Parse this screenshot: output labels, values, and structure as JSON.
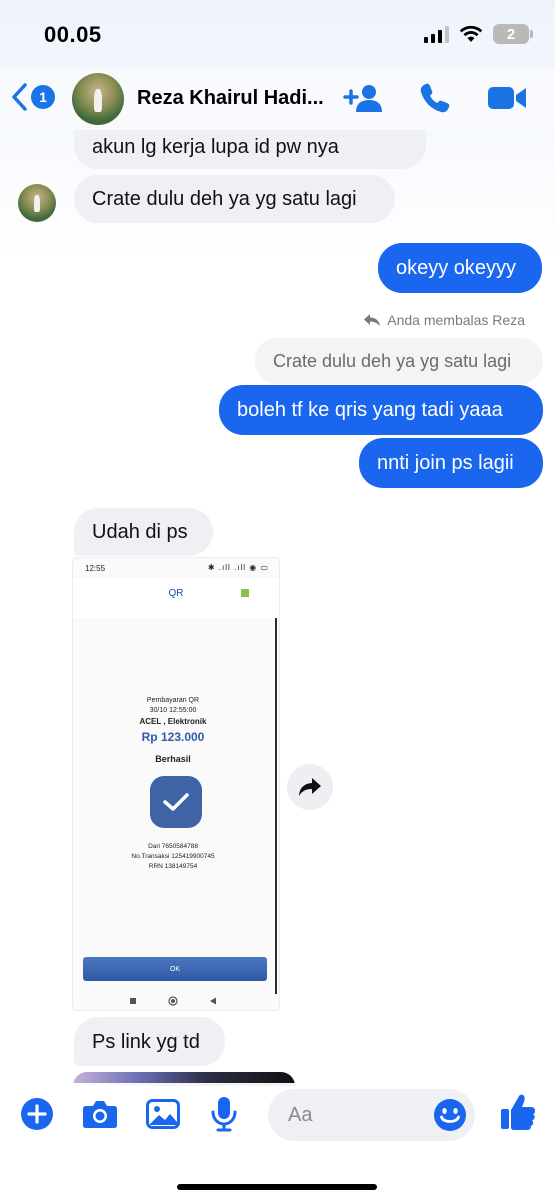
{
  "status_bar": {
    "time": "00.05",
    "battery": "2"
  },
  "header": {
    "back_badge": "1",
    "contact_name": "Reza Khairul Hadi..."
  },
  "messages": [
    {
      "type": "in",
      "text": "akun lg kerja lupa id pw nya"
    },
    {
      "type": "in",
      "text": "Crate dulu deh ya yg satu lagi"
    },
    {
      "type": "out",
      "text": "okeyy okeyyy"
    },
    {
      "type": "reply_note",
      "text": "Anda membalas Reza"
    },
    {
      "type": "quote",
      "text": "Crate dulu deh ya yg satu lagi"
    },
    {
      "type": "out",
      "text": "boleh tf ke qris yang tadi yaaa"
    },
    {
      "type": "out",
      "text": "nnti join ps lagii"
    },
    {
      "type": "in",
      "text": "Udah di ps"
    },
    {
      "type": "in",
      "text": "Ps link yg td"
    }
  ],
  "screenshot": {
    "time": "12:55",
    "status_icons": "✱ .ıll .ıll ◉ ▭",
    "header_title": "QR",
    "payment_label": "Pembayaran QR",
    "datetime": "30/10 12:55:00",
    "merchant": "ACEL , Elektronik",
    "amount": "Rp 123.000",
    "result": "Berhasil",
    "from": "Dari 7650584788",
    "transaction": "No.Transaksi 125419900745",
    "rrn": "RRN 138149754",
    "ok_button": "OK"
  },
  "composer": {
    "placeholder": "Aa"
  },
  "colors": {
    "accent": "#1a66ef",
    "incoming": "#eff0f3",
    "header_badge": "#1b74e4"
  }
}
